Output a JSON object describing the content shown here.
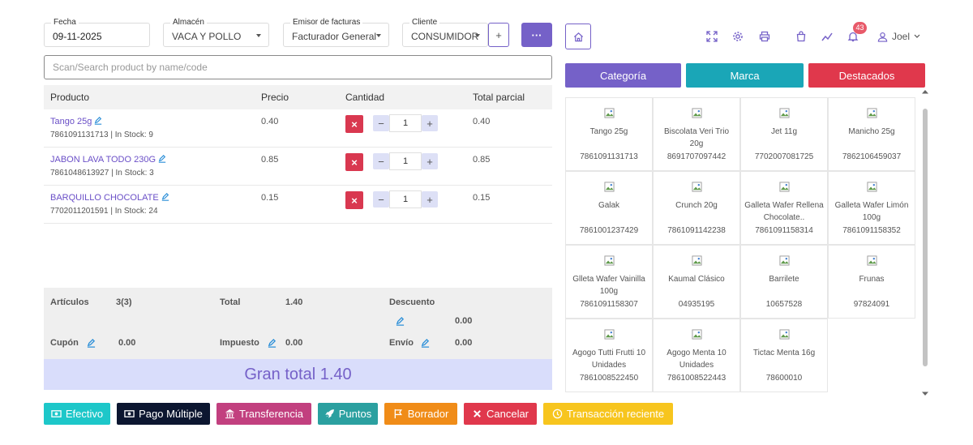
{
  "form": {
    "fecha": {
      "label": "Fecha",
      "value": "09-11-2025"
    },
    "almacen": {
      "label": "Almacén",
      "value": "VACA Y POLLO"
    },
    "emisor": {
      "label": "Emisor de facturas",
      "value": "Facturador General"
    },
    "cliente": {
      "label": "Cliente",
      "value": "CONSUMIDOR"
    },
    "add_label": "+",
    "more_label": "···"
  },
  "search": {
    "placeholder": "Scan/Search product by name/code"
  },
  "table": {
    "headers": {
      "producto": "Producto",
      "precio": "Precio",
      "cantidad": "Cantidad",
      "total": "Total parcial"
    },
    "rows": [
      {
        "name": "Tango 25g",
        "code": "7861091131713",
        "stock": "In Stock: 9",
        "price": "0.40",
        "qty": "1",
        "total": "0.40"
      },
      {
        "name": "JABON LAVA TODO 230G",
        "code": "7861048613927",
        "stock": "In Stock: 3",
        "price": "0.85",
        "qty": "1",
        "total": "0.85"
      },
      {
        "name": "BARQUILLO CHOCOLATE",
        "code": "7702011201591",
        "stock": "In Stock: 24",
        "price": "0.15",
        "qty": "1",
        "total": "0.15"
      }
    ],
    "delete_label": "×",
    "minus_label": "−",
    "plus_label": "+"
  },
  "summary": {
    "articulos_label": "Artículos",
    "articulos_value": "3(3)",
    "total_label": "Total",
    "total_value": "1.40",
    "descuento_label": "Descuento",
    "descuento_value": "0.00",
    "cupon_label": "Cupón",
    "cupon_value": "0.00",
    "impuesto_label": "Impuesto",
    "impuesto_value": "0.00",
    "envio_label": "Envío",
    "envio_value": "0.00",
    "gran_total": "Gran total 1.40"
  },
  "actions": {
    "efectivo": "Efectivo",
    "pago_multiple": "Pago Múltiple",
    "transferencia": "Transferencia",
    "puntos": "Puntos",
    "borrador": "Borrador",
    "cancelar": "Cancelar",
    "reciente": "Transacción reciente"
  },
  "header": {
    "notification_count": "43",
    "user_name": "Joel",
    "icons": [
      "home-icon",
      "fullscreen-icon",
      "settings-icon",
      "print-icon",
      "bag-icon",
      "chart-icon",
      "bell-icon",
      "user-icon"
    ]
  },
  "tabs": {
    "categoria": "Categoría",
    "marca": "Marca",
    "destacados": "Destacados"
  },
  "colors": {
    "primary": "#7561c8",
    "teal": "#1aa6b7",
    "red": "#e0384c",
    "efectivo": "#1dc7c9",
    "pago_multiple": "#0c1630",
    "transferencia": "#c2407f",
    "puntos": "#2ba0a0",
    "borrador": "#f08c18",
    "cancelar": "#e0384c",
    "reciente": "#f7c51e"
  },
  "products": [
    {
      "name": "Tango 25g",
      "code": "7861091131713"
    },
    {
      "name": "Biscolata Veri Trio 20g",
      "code": "8691707097442"
    },
    {
      "name": "Jet 11g",
      "code": "7702007081725"
    },
    {
      "name": "Manicho 25g",
      "code": "7862106459037"
    },
    {
      "name": "Galak",
      "code": "7861001237429"
    },
    {
      "name": "Crunch 20g",
      "code": "7861091142238"
    },
    {
      "name": "Galleta Wafer Rellena Chocolate..",
      "code": "7861091158314"
    },
    {
      "name": "Galleta Wafer Limón 100g",
      "code": "7861091158352"
    },
    {
      "name": "Glleta Wafer Vainilla 100g",
      "code": "7861091158307"
    },
    {
      "name": "Kaumal Clásico",
      "code": "04935195"
    },
    {
      "name": "Barrilete",
      "code": "10657528"
    },
    {
      "name": "Frunas",
      "code": "97824091"
    },
    {
      "name": "Agogo Tutti Frutti 10 Unidades",
      "code": "7861008522450"
    },
    {
      "name": "Agogo Menta 10 Unidades",
      "code": "7861008522443"
    },
    {
      "name": "Tictac Menta 16g",
      "code": "78600010"
    }
  ]
}
